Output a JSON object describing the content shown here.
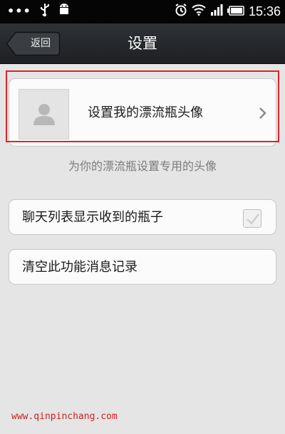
{
  "status_bar": {
    "dots": "•••",
    "time": "15:36",
    "icons": [
      "usb-icon",
      "android-icon",
      "alarm-icon",
      "wifi-icon",
      "signal-icon",
      "battery-icon"
    ]
  },
  "header": {
    "back_label": "返回",
    "title": "设置"
  },
  "avatar_setting": {
    "label": "设置我的漂流瓶头像",
    "hint": "为你的漂流瓶设置专用的头像",
    "icon": "default-avatar-icon",
    "chevron": "chevron-right-icon"
  },
  "settings": [
    {
      "label": "聊天列表显示收到的瓶子",
      "checked": true
    },
    {
      "label": "清空此功能消息记录"
    }
  ],
  "watermark": "www.qinpinchang.com",
  "colors": {
    "highlight": "#e0222a",
    "background": "#e5e5e5",
    "header": "#2a2c30"
  }
}
